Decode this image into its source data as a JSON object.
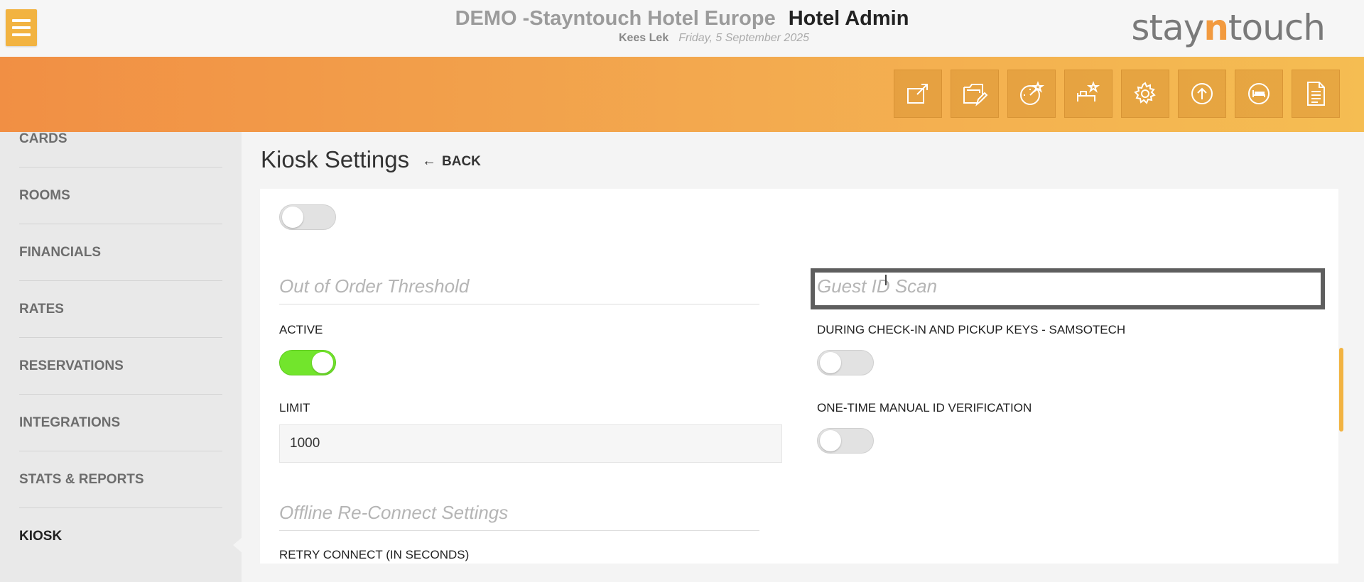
{
  "header": {
    "hotel_name": "DEMO -Stayntouch Hotel Europe",
    "section": "Hotel Admin",
    "user": "Kees Lek",
    "date": "Friday, 5 September 2025",
    "logo_pre": "stay",
    "logo_n": "n",
    "logo_post": "touch"
  },
  "toolbar": {
    "icons": [
      "external-link-icon",
      "folder-edit-icon",
      "dashboard-star-icon",
      "housekeeping-star-icon",
      "gear-icon",
      "upload-icon",
      "bed-icon",
      "document-icon"
    ]
  },
  "sidebar": {
    "items": [
      {
        "label": "CARDS"
      },
      {
        "label": "ROOMS"
      },
      {
        "label": "FINANCIALS"
      },
      {
        "label": "RATES"
      },
      {
        "label": "RESERVATIONS"
      },
      {
        "label": "INTEGRATIONS"
      },
      {
        "label": "STATS & REPORTS"
      },
      {
        "label": "KIOSK"
      }
    ],
    "active": "KIOSK"
  },
  "page": {
    "title": "Kiosk Settings",
    "back_label": "BACK"
  },
  "settings": {
    "top_toggle_on": false,
    "out_of_order": {
      "title": "Out of Order Threshold",
      "active_label": "ACTIVE",
      "active_on": true,
      "limit_label": "LIMIT",
      "limit_value": "1000"
    },
    "guest_id_scan": {
      "title": "Guest ID Scan",
      "checkin_label": "DURING CHECK-IN AND PICKUP KEYS - SAMSOTECH",
      "checkin_on": false,
      "manual_label": "ONE-TIME MANUAL ID VERIFICATION",
      "manual_on": false
    },
    "offline": {
      "title": "Offline Re-Connect Settings",
      "retry_label": "RETRY CONNECT (IN SECONDS)"
    }
  },
  "colors": {
    "accent": "#f2b341",
    "band_start": "#f18f44",
    "band_end": "#f5bd52",
    "toggle_on": "#72e52c"
  }
}
